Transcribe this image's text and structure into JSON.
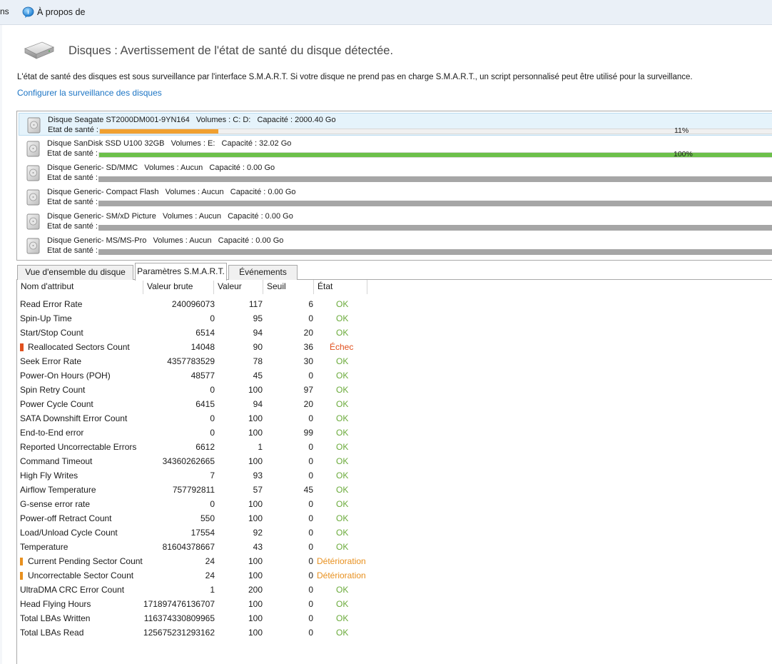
{
  "menu": {
    "cut_label": "ns",
    "about_label": "À propos de"
  },
  "header": {
    "title": "Disques : Avertissement de l'état de santé du disque détectée.",
    "info": "L'état de santé des disques est sous surveillance par l'interface S.M.A.R.T. Si votre disque ne prend pas en charge S.M.A.R.T., un script personnalisé peut être utilisé pour la surveillance.",
    "config_link": "Configurer la surveillance des disques"
  },
  "disks": [
    {
      "name": "Disque Seagate ST2000DM001-9YN164   Volumes : C: D:   Capacité : 2000.40 Go",
      "health_label": "Etat de santé :",
      "health": 11,
      "health_text": "11%",
      "bar_color": "#f0a030",
      "selected": true
    },
    {
      "name": "Disque SanDisk SSD U100 32GB   Volumes : E:   Capacité : 32.02 Go",
      "health_label": "Etat de santé :",
      "health": 100,
      "health_text": "100%",
      "bar_color": "#6cc04a",
      "selected": false
    },
    {
      "name": "Disque Generic- SD/MMC   Volumes : Aucun   Capacité : 0.00 Go",
      "health_label": "Etat de santé :",
      "health": null,
      "health_text": "",
      "bar_color": "#a6a6a6",
      "selected": false
    },
    {
      "name": "Disque Generic- Compact Flash   Volumes : Aucun   Capacité : 0.00 Go",
      "health_label": "Etat de santé :",
      "health": null,
      "health_text": "",
      "bar_color": "#a6a6a6",
      "selected": false
    },
    {
      "name": "Disque Generic- SM/xD Picture   Volumes : Aucun   Capacité : 0.00 Go",
      "health_label": "Etat de santé :",
      "health": null,
      "health_text": "",
      "bar_color": "#a6a6a6",
      "selected": false
    },
    {
      "name": "Disque Generic- MS/MS-Pro   Volumes : Aucun   Capacité : 0.00 Go",
      "health_label": "Etat de santé :",
      "health": null,
      "health_text": "",
      "bar_color": "#a6a6a6",
      "selected": false
    }
  ],
  "tabs": [
    {
      "label": "Vue d'ensemble du disque",
      "active": false
    },
    {
      "label": "Paramètres S.M.A.R.T.",
      "active": true
    },
    {
      "label": "Événements",
      "active": false
    }
  ],
  "columns": [
    "Nom d'attribut",
    "Valeur brute",
    "Valeur",
    "Seuil",
    "État"
  ],
  "status_colors": {
    "ok": "#6aaa3a",
    "fail": "#e0501e",
    "warn": "#e8901e",
    "flag_fail": "#e0501e",
    "flag_warn": "#e8901e"
  },
  "attributes": [
    {
      "name": "Read Error Rate",
      "raw": "240096073",
      "value": "117",
      "threshold": "6",
      "status": "OK",
      "level": "ok"
    },
    {
      "name": "Spin-Up Time",
      "raw": "0",
      "value": "95",
      "threshold": "0",
      "status": "OK",
      "level": "ok"
    },
    {
      "name": "Start/Stop Count",
      "raw": "6514",
      "value": "94",
      "threshold": "20",
      "status": "OK",
      "level": "ok"
    },
    {
      "name": "Reallocated Sectors Count",
      "raw": "14048",
      "value": "90",
      "threshold": "36",
      "status": "Échec",
      "level": "fail"
    },
    {
      "name": "Seek Error Rate",
      "raw": "4357783529",
      "value": "78",
      "threshold": "30",
      "status": "OK",
      "level": "ok"
    },
    {
      "name": "Power-On Hours (POH)",
      "raw": "48577",
      "value": "45",
      "threshold": "0",
      "status": "OK",
      "level": "ok"
    },
    {
      "name": "Spin Retry Count",
      "raw": "0",
      "value": "100",
      "threshold": "97",
      "status": "OK",
      "level": "ok"
    },
    {
      "name": "Power Cycle Count",
      "raw": "6415",
      "value": "94",
      "threshold": "20",
      "status": "OK",
      "level": "ok"
    },
    {
      "name": "SATA Downshift Error Count",
      "raw": "0",
      "value": "100",
      "threshold": "0",
      "status": "OK",
      "level": "ok"
    },
    {
      "name": "End-to-End error",
      "raw": "0",
      "value": "100",
      "threshold": "99",
      "status": "OK",
      "level": "ok"
    },
    {
      "name": "Reported Uncorrectable Errors",
      "raw": "6612",
      "value": "1",
      "threshold": "0",
      "status": "OK",
      "level": "ok"
    },
    {
      "name": "Command Timeout",
      "raw": "34360262665",
      "value": "100",
      "threshold": "0",
      "status": "OK",
      "level": "ok"
    },
    {
      "name": "High Fly Writes",
      "raw": "7",
      "value": "93",
      "threshold": "0",
      "status": "OK",
      "level": "ok"
    },
    {
      "name": "Airflow Temperature",
      "raw": "757792811",
      "value": "57",
      "threshold": "45",
      "status": "OK",
      "level": "ok"
    },
    {
      "name": "G-sense error rate",
      "raw": "0",
      "value": "100",
      "threshold": "0",
      "status": "OK",
      "level": "ok"
    },
    {
      "name": "Power-off Retract Count",
      "raw": "550",
      "value": "100",
      "threshold": "0",
      "status": "OK",
      "level": "ok"
    },
    {
      "name": "Load/Unload Cycle Count",
      "raw": "17554",
      "value": "92",
      "threshold": "0",
      "status": "OK",
      "level": "ok"
    },
    {
      "name": "Temperature",
      "raw": "81604378667",
      "value": "43",
      "threshold": "0",
      "status": "OK",
      "level": "ok"
    },
    {
      "name": "Current Pending Sector Count",
      "raw": "24",
      "value": "100",
      "threshold": "0",
      "status": "Détérioration",
      "level": "warn"
    },
    {
      "name": "Uncorrectable Sector Count",
      "raw": "24",
      "value": "100",
      "threshold": "0",
      "status": "Détérioration",
      "level": "warn"
    },
    {
      "name": "UltraDMA CRC Error Count",
      "raw": "1",
      "value": "200",
      "threshold": "0",
      "status": "OK",
      "level": "ok"
    },
    {
      "name": "Head Flying Hours",
      "raw": "171897476136707",
      "value": "100",
      "threshold": "0",
      "status": "OK",
      "level": "ok"
    },
    {
      "name": "Total LBAs Written",
      "raw": "116374330809965",
      "value": "100",
      "threshold": "0",
      "status": "OK",
      "level": "ok"
    },
    {
      "name": "Total LBAs Read",
      "raw": "125675231293162",
      "value": "100",
      "threshold": "0",
      "status": "OK",
      "level": "ok"
    }
  ]
}
